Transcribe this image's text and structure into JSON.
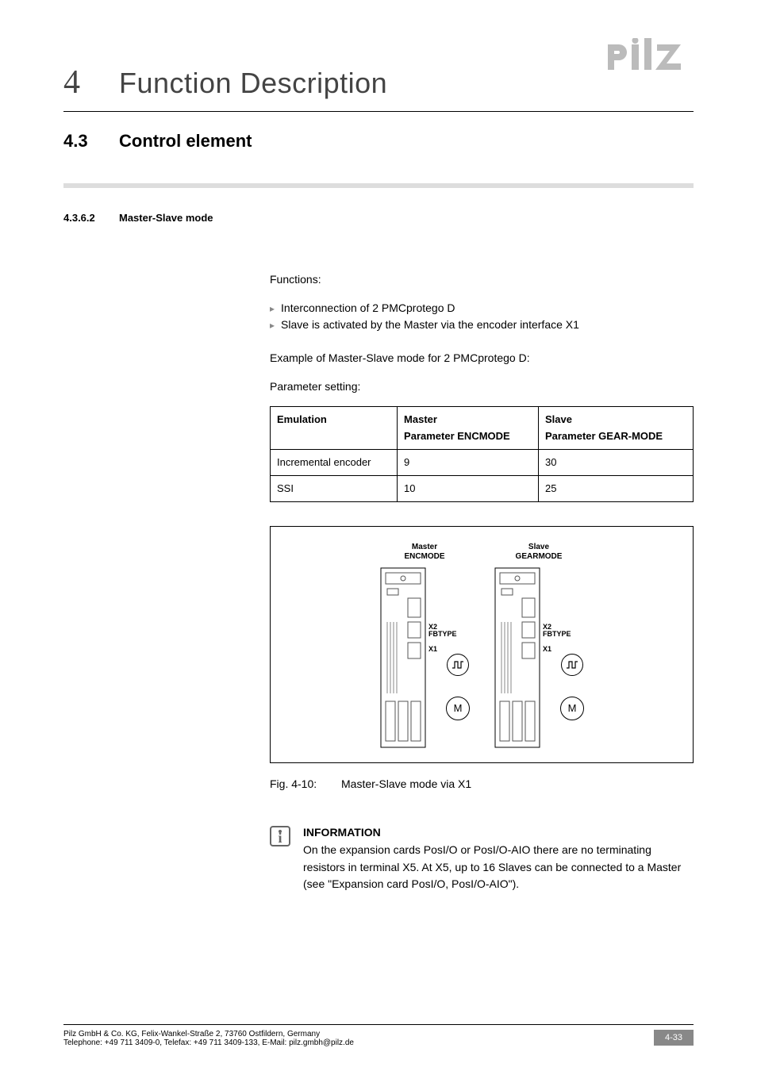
{
  "header": {
    "chapter_number": "4",
    "chapter_title": "Function Description",
    "logo_text": "pilz"
  },
  "section": {
    "number": "4.3",
    "title": "Control element"
  },
  "subsection": {
    "number": "4.3.6.2",
    "title": "Master-Slave mode"
  },
  "body": {
    "functions_label": "Functions:",
    "bullets": [
      "Interconnection of 2 PMCprotego D",
      "Slave is activated by the Master via the encoder interface X1"
    ],
    "example_text": "Example of Master-Slave mode for 2 PMCprotego D:",
    "param_label": "Parameter setting:"
  },
  "table": {
    "head": {
      "c1": "Emulation",
      "c2": "Master\nParameter ENCMODE",
      "c3": "Slave\nParameter GEAR-MODE"
    },
    "rows": [
      {
        "c1": "Incremental encoder",
        "c2": "9",
        "c3": "30"
      },
      {
        "c1": "SSI",
        "c2": "10",
        "c3": "25"
      }
    ]
  },
  "figure": {
    "master_top1": "Master",
    "master_top2": "ENCMODE",
    "slave_top1": "Slave",
    "slave_top2": "GEARMODE",
    "x2_label": "X2  FBTYPE",
    "x1_label": "X1",
    "motor_label": "M",
    "caption_num": "Fig. 4-10:",
    "caption_text": "Master-Slave mode via X1"
  },
  "info": {
    "heading": "INFORMATION",
    "text": "On the expansion cards PosI/O or PosI/O-AIO there are no terminating resistors in terminal X5. At X5, up to 16 Slaves can be connected to a Master (see \"Expansion card PosI/O, PosI/O-AIO\")."
  },
  "footer": {
    "line1": "Pilz GmbH & Co. KG, Felix-Wankel-Straße 2, 73760 Ostfildern, Germany",
    "line2": "Telephone: +49 711 3409-0, Telefax: +49 711 3409-133, E-Mail: pilz.gmbh@pilz.de",
    "page": "4-33"
  }
}
